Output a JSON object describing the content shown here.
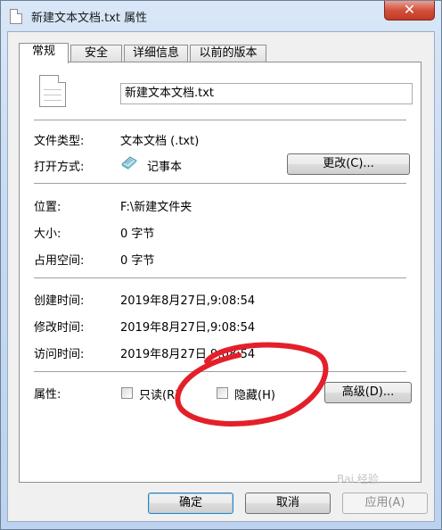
{
  "window": {
    "title": "新建文本文档.txt 属性",
    "close_label": "✕"
  },
  "tabs": [
    {
      "label": "常规",
      "active": true
    },
    {
      "label": "安全",
      "active": false
    },
    {
      "label": "详细信息",
      "active": false
    },
    {
      "label": "以前的版本",
      "active": false
    }
  ],
  "general": {
    "file_name": "新建文本文档.txt",
    "type_label": "文件类型:",
    "type_value": "文本文档 (.txt)",
    "opens_with_label": "打开方式:",
    "opens_with_value": "记事本",
    "change_button": "更改(C)...",
    "location_label": "位置:",
    "location_value": "F:\\新建文件夹",
    "size_label": "大小:",
    "size_value": "0 字节",
    "size_on_disk_label": "占用空间:",
    "size_on_disk_value": "0 字节",
    "created_label": "创建时间:",
    "created_value": "2019年8月27日,9:08:54",
    "modified_label": "修改时间:",
    "modified_value": "2019年8月27日,9:08:54",
    "accessed_label": "访问时间:",
    "accessed_value": "2019年8月27日,9:08:54",
    "attributes_label": "属性:",
    "readonly_label": "只读(R)",
    "hidden_label": "隐藏(H)",
    "advanced_button": "高级(D)..."
  },
  "footer": {
    "ok": "确定",
    "cancel": "取消",
    "apply": "应用(A)"
  },
  "annotation": {
    "color": "#e3202a"
  },
  "watermark": "Bai 经验"
}
